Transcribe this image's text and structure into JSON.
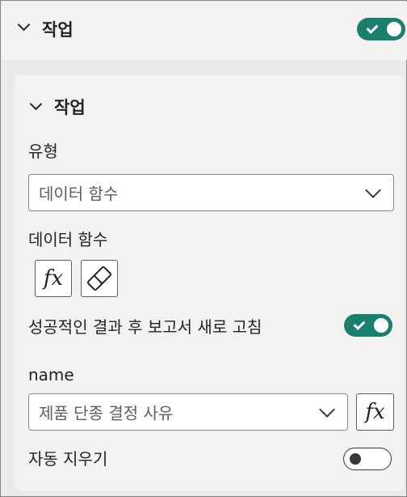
{
  "section": {
    "title": "작업",
    "enabled": true
  },
  "card": {
    "title": "작업",
    "type_label": "유형",
    "type_value": "데이터 함수",
    "function_label": "데이터 함수",
    "function_buttons": [
      "fx-icon",
      "eraser-icon"
    ],
    "refresh_label": "성공적인 결과 후 보고서 새로 고침",
    "refresh_enabled": true,
    "name_label": "name",
    "name_value": "제품 단종 결정 사유",
    "name_fx_label": "fx",
    "fx_label": "fx",
    "auto_clear_label": "자동 지우기",
    "auto_clear_enabled": false
  },
  "colors": {
    "toggle_on": "#1a7f6c",
    "panel_bg": "#f3f2f1",
    "frame_bg": "#eaeaea"
  }
}
